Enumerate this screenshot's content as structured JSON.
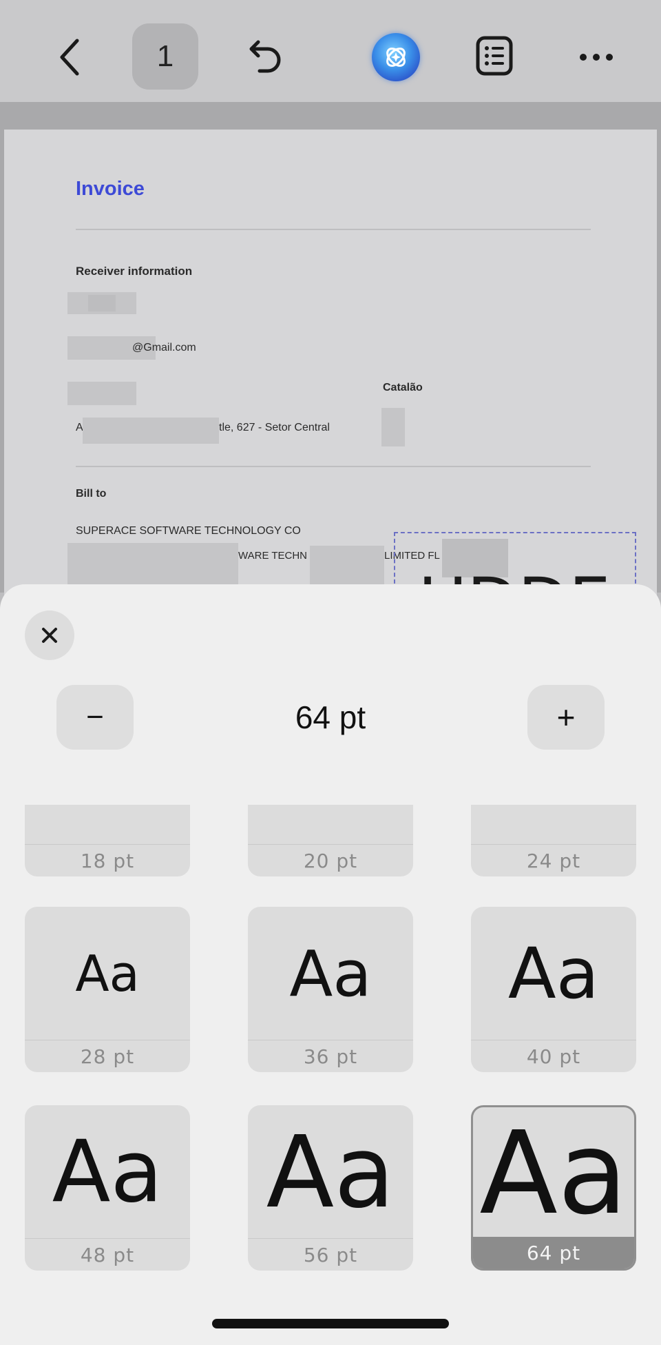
{
  "toolbar": {
    "back_icon": "chevron-left-icon",
    "page_number": "1",
    "undo_icon": "undo-icon",
    "ai_icon": "ai-assistant-orb-icon",
    "outline_icon": "list-icon",
    "more_icon": "ellipsis-icon"
  },
  "document": {
    "title": "Invoice",
    "receiver_heading": "Receiver information",
    "receiver_email_suffix": "@Gmail.com",
    "receiver_city": "Catalão",
    "receiver_address_prefix": "A",
    "receiver_address_suffix": "tle, 627 - Setor Central",
    "bill_to_heading": "Bill to",
    "bill_to_company": "SUPERACE SOFTWARE TECHNOLOGY CO",
    "bill_to_line2_mid": "WARE TECHN",
    "bill_to_line2_end": "LIMITED FL",
    "text_box_content": "UDDE",
    "accent_color": "#3d4ad6"
  },
  "font_size_sheet": {
    "close_icon": "close-icon",
    "decrease_label": "−",
    "increase_label": "+",
    "current_size": "64 pt",
    "preview_text": "Aa",
    "options": [
      {
        "label": "18 pt"
      },
      {
        "label": "20 pt"
      },
      {
        "label": "24 pt"
      },
      {
        "label": "28 pt"
      },
      {
        "label": "36 pt"
      },
      {
        "label": "40 pt"
      },
      {
        "label": "48 pt"
      },
      {
        "label": "56 pt"
      },
      {
        "label": "64 pt",
        "selected": true
      }
    ]
  }
}
